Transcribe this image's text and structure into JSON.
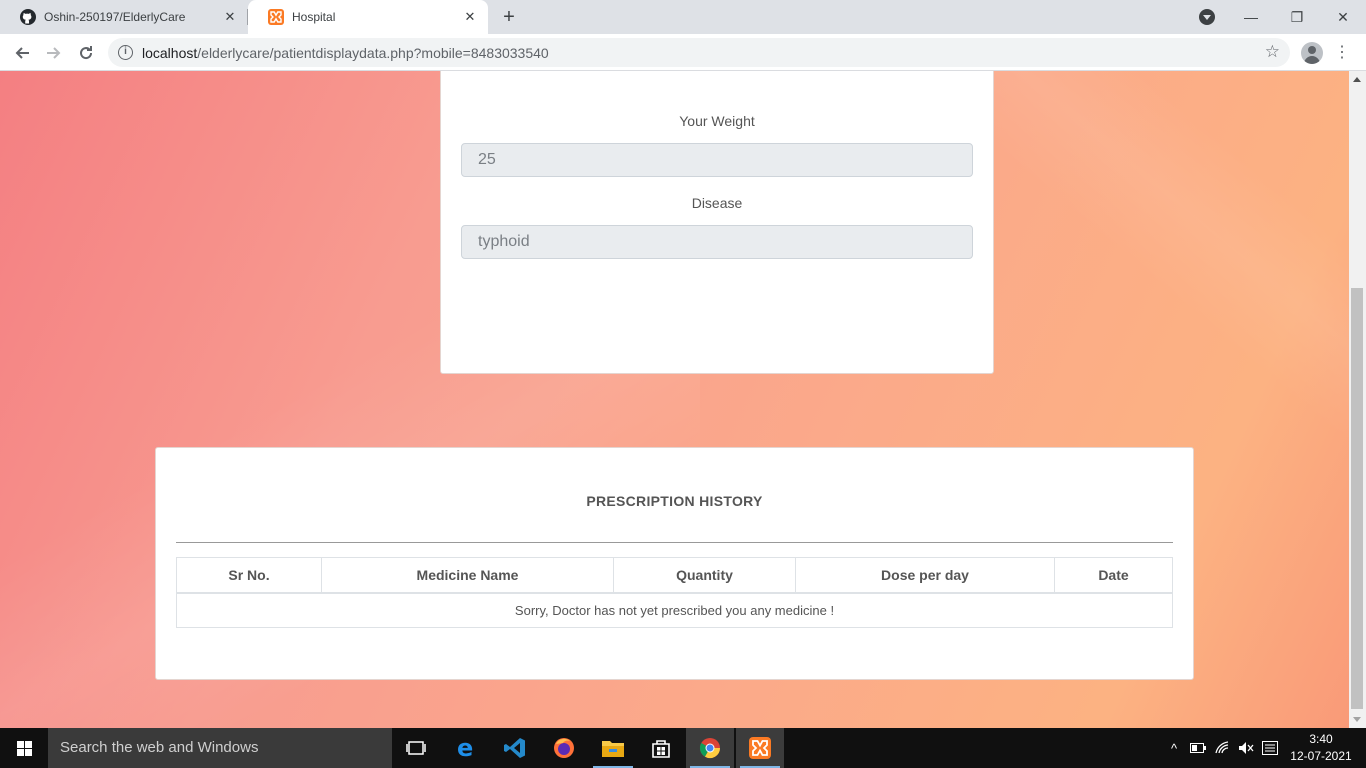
{
  "browser": {
    "tabs": [
      {
        "title": "Oshin-250197/ElderlyCare",
        "icon": "github-icon",
        "active": false
      },
      {
        "title": "Hospital",
        "icon": "xampp-icon",
        "active": true
      }
    ],
    "url_host": "localhost",
    "url_path": "/elderlycare/patientdisplaydata.php?mobile=8483033540"
  },
  "form": {
    "weight_label": "Your Weight",
    "weight_value": "25",
    "disease_label": "Disease",
    "disease_value": "typhoid"
  },
  "prescription": {
    "title": "PRESCRIPTION HISTORY",
    "columns": [
      "Sr No.",
      "Medicine Name",
      "Quantity",
      "Dose per day",
      "Date"
    ],
    "empty_message": "Sorry, Doctor has not yet prescribed you any medicine !"
  },
  "taskbar": {
    "search_placeholder": "Search the web and Windows",
    "apps": [
      "task-view-icon",
      "edge-icon",
      "vscode-icon",
      "firefox-icon",
      "file-explorer-icon",
      "store-icon",
      "chrome-icon",
      "xampp-icon"
    ],
    "time": "3:40",
    "date": "12-07-2021"
  },
  "colors": {
    "page_gradient_start": "#f47f82",
    "page_gradient_end": "#fcb282",
    "input_disabled_bg": "#e9ecef",
    "taskbar_bg": "#101010"
  }
}
